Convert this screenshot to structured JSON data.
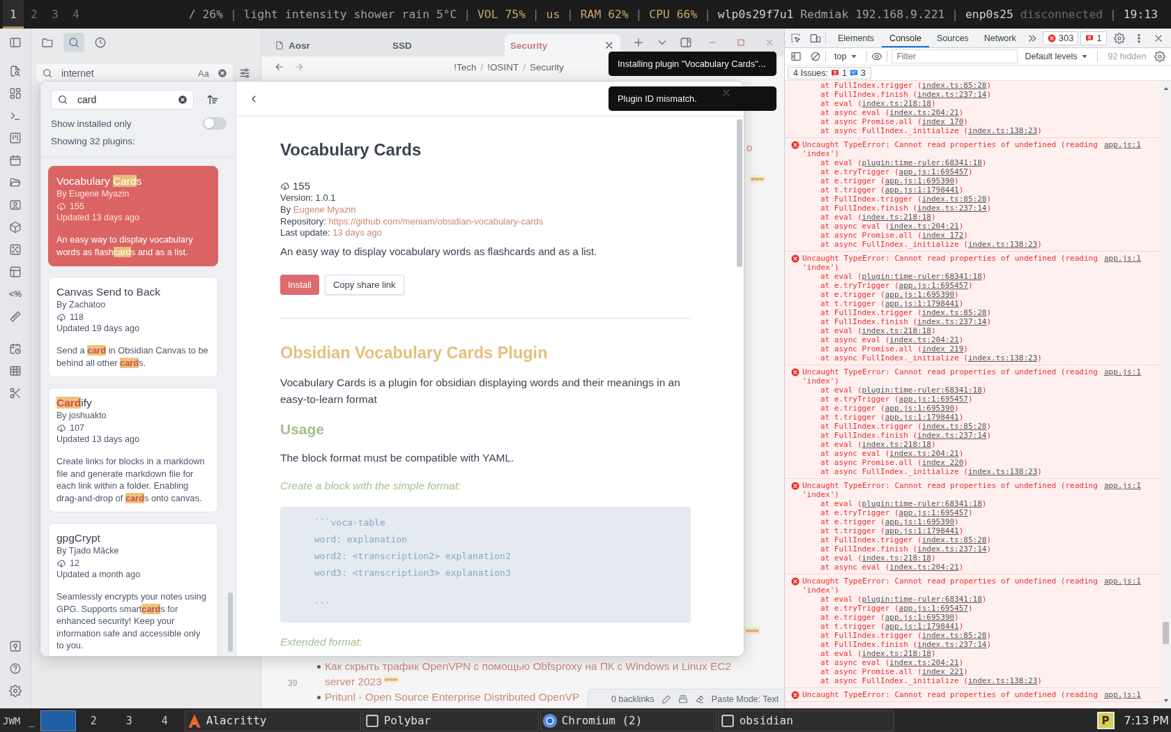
{
  "top_bar": {
    "workspaces": [
      {
        "label": "1",
        "selected": true
      },
      {
        "label": "2",
        "selected": false
      },
      {
        "label": "3",
        "selected": false
      },
      {
        "label": "4",
        "selected": false
      }
    ],
    "modules": [
      {
        "kind": "module",
        "text": "/ 26%",
        "color": "#a0a0a0"
      },
      {
        "kind": "sep",
        "text": "|"
      },
      {
        "kind": "module",
        "text": "light intensity shower rain 5°C",
        "color": "#a0a0a0"
      },
      {
        "kind": "sep",
        "text": "|"
      },
      {
        "kind": "module",
        "text": "VOL 75%",
        "color": "#c8a46a"
      },
      {
        "kind": "sep",
        "text": "|"
      },
      {
        "kind": "module",
        "text": "us",
        "color": "#c8a46a"
      },
      {
        "kind": "sep",
        "text": "|"
      },
      {
        "kind": "module",
        "text": "RAM 62%",
        "color": "#c8a46a"
      },
      {
        "kind": "sep",
        "text": "|"
      },
      {
        "kind": "module",
        "text": "CPU 66%",
        "color": "#c8a46a"
      },
      {
        "kind": "sep",
        "text": "|"
      },
      {
        "kind": "module",
        "text": "wlp0s29f7u1",
        "color": "#d2d2d2"
      },
      {
        "kind": "module",
        "text": "Redmiak 192.168.9.221",
        "color": "#a0a0a0"
      },
      {
        "kind": "sep",
        "text": "|"
      },
      {
        "kind": "module",
        "text": "enp0s25",
        "color": "#d2d2d2"
      },
      {
        "kind": "module",
        "text": "disconnected",
        "color": "#6c6c6c"
      },
      {
        "kind": "sep",
        "text": "|"
      },
      {
        "kind": "module",
        "text": "19:13",
        "color": "#d2d2d2"
      }
    ]
  },
  "obsidian": {
    "ribbon_glyph": "<%",
    "sidebar": {
      "tabs": [
        {
          "selected": false
        },
        {
          "selected": true
        },
        {
          "selected": false
        }
      ],
      "search": {
        "value": "internet",
        "match_case": "Aa"
      }
    },
    "tabs": [
      {
        "title": "Aosr",
        "kind": "file",
        "selected": false
      },
      {
        "title": "SSD",
        "kind": "note",
        "selected": false
      },
      {
        "title": "Security",
        "kind": "note",
        "selected": true
      }
    ],
    "breadcrumb": [
      {
        "kind": "crumb",
        "text": "!Tech"
      },
      {
        "kind": "sep",
        "text": "/"
      },
      {
        "kind": "crumb",
        "text": "!OSINT"
      },
      {
        "kind": "sep",
        "text": "/"
      },
      {
        "kind": "crumb",
        "text": "Security"
      }
    ],
    "note": {
      "fragments": [
        {
          "kind": "text",
          "text": "o"
        },
        {
          "kind": "badge",
          "text": "www"
        },
        {
          "kind": "badge",
          "text": "www"
        }
      ],
      "line_number": "39",
      "items": [
        {
          "text": "Как скрыть трафик OpenVPN с помощью Obfsproxy на ПК с Windows и Linux EC2 server 2023",
          "badge": "www"
        },
        {
          "text": "Pritunl - Open Source Enterprise Distributed OpenVP"
        }
      ]
    },
    "status_bar": {
      "backlinks": "0 backlinks",
      "paste_mode": "Paste Mode: Text"
    }
  },
  "plugin_browser": {
    "search": {
      "value": "card"
    },
    "installed_only": {
      "label": "Show installed only",
      "on": false
    },
    "count": "Showing 32 plugins:",
    "plugins": [
      {
        "name": "Vocabulary **Card**s",
        "author": "By Eugene Myazin",
        "downloads": "155",
        "updated": "Updated 13 days ago",
        "description": "An easy way to display vocabulary words as flash**card**s and as a list.",
        "selected": true
      },
      {
        "name": "Canvas Send to Back",
        "author": "By Zachatoo",
        "downloads": "118",
        "updated": "Updated 19 days ago",
        "description": "Send a **card** in Obsidian Canvas to be behind all other **card**s.",
        "selected": false
      },
      {
        "name": "**Card**ify",
        "author": "By joshuakto",
        "downloads": "107",
        "updated": "Updated 13 days ago",
        "description": "Create links for blocks in a markdown file and generate markdown file for each link within a folder. Enabling drag-and-drop of **card**s onto canvas.",
        "selected": false
      },
      {
        "name": "gpgCrypt",
        "author": "By Tjado Mäcke",
        "downloads": "12",
        "updated": "Updated a month ago",
        "description": "Seamlessly encrypts your notes using GPG. Supports smart**card**s for enhanced security! Keep your information safe and accessible only to you.",
        "selected": false
      }
    ],
    "detail": {
      "title": "Vocabulary Cards",
      "downloads": "155",
      "version": "Version: 1.0.1",
      "author_label": "By",
      "author": "Eugene Myazin",
      "repo_label": "Repository:",
      "repo": "https://github.com/meniam/obsidian-vocabulary-cards",
      "update_label": "Last update:",
      "update": "13 days ago",
      "description": "An easy way to display vocabulary words as flashcards and as a list.",
      "buttons": [
        {
          "label": "Install",
          "kind": "primary"
        },
        {
          "label": "Copy share link",
          "kind": "secondary"
        }
      ],
      "readme": [
        {
          "kind": "h1",
          "text": "Obsidian Vocabulary Cards Plugin"
        },
        {
          "kind": "p",
          "text": "Vocabulary Cards is a plugin for obsidian displaying words and their meanings in an easy-to-learn format"
        },
        {
          "kind": "h2",
          "text": "Usage"
        },
        {
          "kind": "p",
          "text": "The block format must be compatible with YAML."
        },
        {
          "kind": "em",
          "text": "Create a block with the simple format:"
        },
        {
          "kind": "code",
          "text": "```voca-table\nword: explanation\nword2: <transcription2> explanation2\nword3: <transcription3> explanation3\n\n```"
        },
        {
          "kind": "em",
          "text": "Extended format:"
        }
      ]
    }
  },
  "toasts": [
    "Installing plugin \"Vocabulary Cards\"...",
    "Plugin ID mismatch."
  ],
  "devtools": {
    "tabs": [
      {
        "label": "Elements",
        "selected": false
      },
      {
        "label": "Console",
        "selected": true
      },
      {
        "label": "Sources",
        "selected": false
      },
      {
        "label": "Network",
        "selected": false
      }
    ],
    "error_count": "303",
    "issue_count": "1",
    "context": "top",
    "filter": {
      "placeholder": "Filter"
    },
    "levels": "Default levels",
    "hidden": "92 hidden",
    "issues": {
      "label": "4 Issues:",
      "errors": "1",
      "infos": "3"
    },
    "log": [
      {
        "kind": "continuation",
        "stack": [
          {
            "text": "at FullIndex.trigger (",
            "link": "index.ts:85:28",
            "end": ")"
          },
          {
            "text": "at FullIndex.finish (",
            "link": "index.ts:237:14",
            "end": ")"
          },
          {
            "text": "at eval (",
            "link": "index.ts:218:18",
            "end": ")"
          },
          {
            "text": "at async eval (",
            "link": "index.ts:204:21",
            "end": ")"
          },
          {
            "text": "at async Promise.all (",
            "link": "index 170",
            "end": ")"
          },
          {
            "text": "at async FullIndex._initialize (",
            "link": "index.ts:138:23",
            "end": ")"
          }
        ]
      },
      {
        "kind": "error",
        "message": "Uncaught TypeError: Cannot read properties of undefined (reading 'index')",
        "source": "app.js:1",
        "stack": [
          {
            "text": "at eval (",
            "link": "plugin:time-ruler:68341:18",
            "end": ")"
          },
          {
            "text": "at e.tryTrigger (",
            "link": "app.js:1:695457",
            "end": ")"
          },
          {
            "text": "at e.trigger (",
            "link": "app.js:1:695390",
            "end": ")"
          },
          {
            "text": "at t.trigger (",
            "link": "app.js:1:1798441",
            "end": ")"
          },
          {
            "text": "at FullIndex.trigger (",
            "link": "index.ts:85:28",
            "end": ")"
          },
          {
            "text": "at FullIndex.finish (",
            "link": "index.ts:237:14",
            "end": ")"
          },
          {
            "text": "at eval (",
            "link": "index.ts:218:18",
            "end": ")"
          },
          {
            "text": "at async eval (",
            "link": "index.ts:204:21",
            "end": ")"
          },
          {
            "text": "at async Promise.all (",
            "link": "index 172",
            "end": ")"
          },
          {
            "text": "at async FullIndex._initialize (",
            "link": "index.ts:138:23",
            "end": ")"
          }
        ]
      },
      {
        "kind": "error",
        "message": "Uncaught TypeError: Cannot read properties of undefined (reading 'index')",
        "source": "app.js:1",
        "stack": [
          {
            "text": "at eval (",
            "link": "plugin:time-ruler:68341:18",
            "end": ")"
          },
          {
            "text": "at e.tryTrigger (",
            "link": "app.js:1:695457",
            "end": ")"
          },
          {
            "text": "at e.trigger (",
            "link": "app.js:1:695390",
            "end": ")"
          },
          {
            "text": "at t.trigger (",
            "link": "app.js:1:1798441",
            "end": ")"
          },
          {
            "text": "at FullIndex.trigger (",
            "link": "index.ts:85:28",
            "end": ")"
          },
          {
            "text": "at FullIndex.finish (",
            "link": "index.ts:237:14",
            "end": ")"
          },
          {
            "text": "at eval (",
            "link": "index.ts:218:18",
            "end": ")"
          },
          {
            "text": "at async eval (",
            "link": "index.ts:204:21",
            "end": ")"
          },
          {
            "text": "at async Promise.all (",
            "link": "index 219",
            "end": ")"
          },
          {
            "text": "at async FullIndex._initialize (",
            "link": "index.ts:138:23",
            "end": ")"
          }
        ]
      },
      {
        "kind": "error",
        "message": "Uncaught TypeError: Cannot read properties of undefined (reading 'index')",
        "source": "app.js:1",
        "stack": [
          {
            "text": "at eval (",
            "link": "plugin:time-ruler:68341:18",
            "end": ")"
          },
          {
            "text": "at e.tryTrigger (",
            "link": "app.js:1:695457",
            "end": ")"
          },
          {
            "text": "at e.trigger (",
            "link": "app.js:1:695390",
            "end": ")"
          },
          {
            "text": "at t.trigger (",
            "link": "app.js:1:1798441",
            "end": ")"
          },
          {
            "text": "at FullIndex.trigger (",
            "link": "index.ts:85:28",
            "end": ")"
          },
          {
            "text": "at FullIndex.finish (",
            "link": "index.ts:237:14",
            "end": ")"
          },
          {
            "text": "at eval (",
            "link": "index.ts:218:18",
            "end": ")"
          },
          {
            "text": "at async eval (",
            "link": "index.ts:204:21",
            "end": ")"
          },
          {
            "text": "at async Promise.all (",
            "link": "index 220",
            "end": ")"
          },
          {
            "text": "at async FullIndex._initialize (",
            "link": "index.ts:138:23",
            "end": ")"
          }
        ]
      },
      {
        "kind": "error",
        "message": "Uncaught TypeError: Cannot read properties of undefined (reading 'index')",
        "source": "app.js:1",
        "stack": [
          {
            "text": "at eval (",
            "link": "plugin:time-ruler:68341:18",
            "end": ")"
          },
          {
            "text": "at e.tryTrigger (",
            "link": "app.js:1:695457",
            "end": ")"
          },
          {
            "text": "at e.trigger (",
            "link": "app.js:1:695390",
            "end": ")"
          },
          {
            "text": "at t.trigger (",
            "link": "app.js:1:1798441",
            "end": ")"
          },
          {
            "text": "at FullIndex.trigger (",
            "link": "index.ts:85:28",
            "end": ")"
          },
          {
            "text": "at FullIndex.finish (",
            "link": "index.ts:237:14",
            "end": ")"
          },
          {
            "text": "at eval (",
            "link": "index.ts:218:18",
            "end": ")"
          },
          {
            "text": "at async eval (",
            "link": "index.ts:204:21",
            "end": ")"
          }
        ]
      },
      {
        "kind": "error",
        "message": "Uncaught TypeError: Cannot read properties of undefined (reading 'index')",
        "source": "app.js:1",
        "stack": [
          {
            "text": "at eval (",
            "link": "plugin:time-ruler:68341:18",
            "end": ")"
          },
          {
            "text": "at e.tryTrigger (",
            "link": "app.js:1:695457",
            "end": ")"
          },
          {
            "text": "at e.trigger (",
            "link": "app.js:1:695390",
            "end": ")"
          },
          {
            "text": "at t.trigger (",
            "link": "app.js:1:1798441",
            "end": ")"
          },
          {
            "text": "at FullIndex.trigger (",
            "link": "index.ts:85:28",
            "end": ")"
          },
          {
            "text": "at FullIndex.finish (",
            "link": "index.ts:237:14",
            "end": ")"
          },
          {
            "text": "at eval (",
            "link": "index.ts:218:18",
            "end": ")"
          },
          {
            "text": "at async eval (",
            "link": "index.ts:204:21",
            "end": ")"
          },
          {
            "text": "at async Promise.all (",
            "link": "index 221",
            "end": ")"
          },
          {
            "text": "at async FullIndex._initialize (",
            "link": "index.ts:138:23",
            "end": ")"
          }
        ]
      },
      {
        "kind": "error",
        "message": "Uncaught TypeError: Cannot read properties of undefined (reading",
        "source": "app.js:1"
      }
    ]
  },
  "taskbar": {
    "label": "JWM",
    "minimize": "_",
    "pager": [
      {
        "selected": true
      },
      {
        "label": "2",
        "selected": false
      },
      {
        "label": "3",
        "selected": false
      },
      {
        "label": "4",
        "selected": false
      }
    ],
    "tasks": [
      {
        "title": "Alacritty",
        "kind": "terminal"
      },
      {
        "title": "Polybar",
        "kind": "window"
      },
      {
        "title": "Chromium (2)",
        "kind": "browser"
      },
      {
        "title": "obsidian",
        "kind": "window"
      }
    ],
    "tray_label": "P",
    "clock": "7:13 PM"
  }
}
